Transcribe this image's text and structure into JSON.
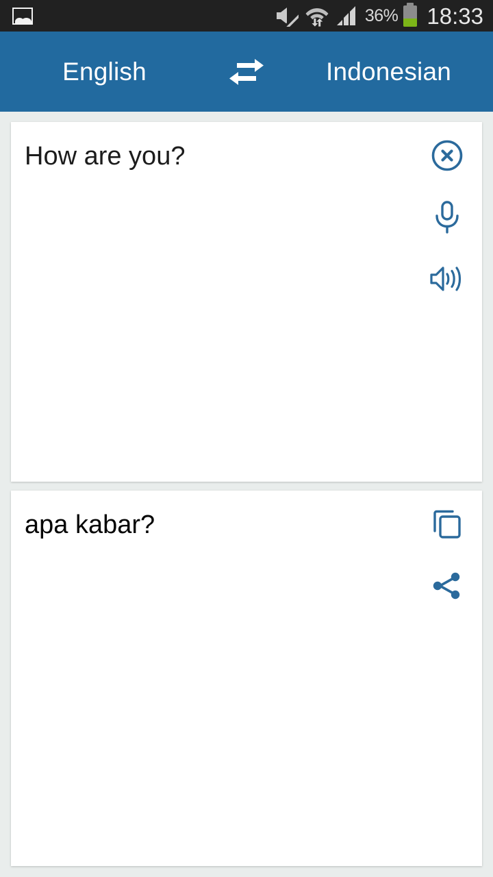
{
  "status_bar": {
    "notification_icon": "gallery-icon",
    "silent_icon": "volume-mute-icon",
    "wifi_icon": "wifi-transfer-icon",
    "signal_icon": "cellular-signal-icon",
    "battery_percent_label": "36%",
    "battery_level": 36,
    "battery_icon": "battery-icon",
    "time": "18:33",
    "background_color": "#212121",
    "text_color": "#d8d8d8"
  },
  "language_bar": {
    "source_language": "English",
    "target_language": "Indonesian",
    "swap_icon": "swap-horizontal-icon",
    "background_color": "#226a9f",
    "text_color": "#ffffff"
  },
  "source_card": {
    "text": "How are you?",
    "actions": [
      {
        "name": "clear",
        "icon": "clear-circle-icon"
      },
      {
        "name": "voice-input",
        "icon": "microphone-icon"
      },
      {
        "name": "speak",
        "icon": "speaker-icon"
      }
    ],
    "background_color": "#ffffff",
    "text_color": "#1c1c1c"
  },
  "target_card": {
    "text": "apa kabar?",
    "actions": [
      {
        "name": "copy",
        "icon": "copy-icon"
      },
      {
        "name": "share",
        "icon": "share-icon"
      }
    ],
    "background_color": "#ffffff",
    "text_color": "#060606"
  },
  "theme": {
    "accent_color": "#226a9f",
    "icon_color": "#2b6a9c",
    "page_background": "#e9edec"
  }
}
